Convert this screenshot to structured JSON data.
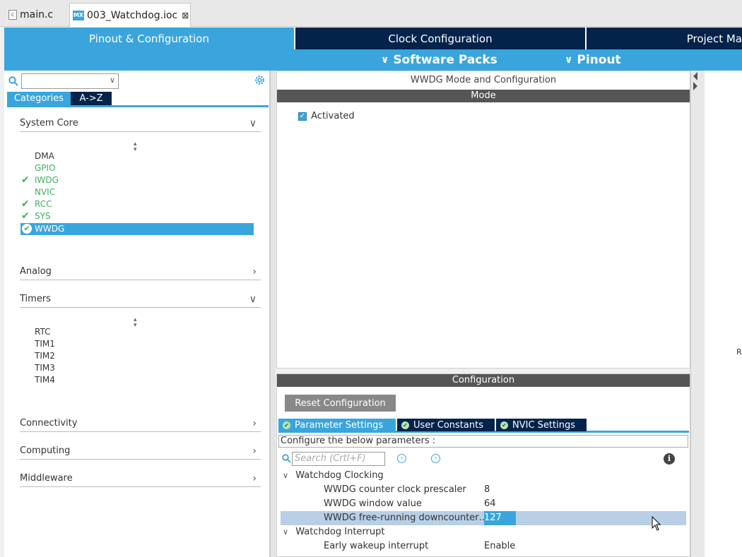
{
  "editor_tabs": [
    {
      "label": "main.c",
      "icon": "c-file-icon",
      "active": false
    },
    {
      "label": "003_Watchdog.ioc",
      "icon": "mx-icon",
      "active": true,
      "close": "⊠"
    }
  ],
  "top_nav": {
    "tabs": [
      "Pinout & Configuration",
      "Clock Configuration",
      "Project Ma"
    ],
    "subnav": [
      "Software Packs",
      "Pinout"
    ]
  },
  "left_panel": {
    "category_tabs": [
      "Categories",
      "A->Z"
    ],
    "sections": {
      "system_core": {
        "label": "System Core",
        "items": [
          {
            "label": "DMA",
            "state": "normal",
            "checked": false
          },
          {
            "label": "GPIO",
            "state": "green",
            "checked": false
          },
          {
            "label": "IWDG",
            "state": "green",
            "checked": true
          },
          {
            "label": "NVIC",
            "state": "green",
            "checked": false
          },
          {
            "label": "RCC",
            "state": "green",
            "checked": true
          },
          {
            "label": "SYS",
            "state": "green",
            "checked": true
          },
          {
            "label": "WWDG",
            "state": "selected",
            "checked": true
          }
        ]
      },
      "analog": {
        "label": "Analog"
      },
      "timers": {
        "label": "Timers",
        "items": [
          "RTC",
          "TIM1",
          "TIM2",
          "TIM3",
          "TIM4"
        ]
      },
      "connectivity": {
        "label": "Connectivity"
      },
      "computing": {
        "label": "Computing"
      },
      "middleware": {
        "label": "Middleware"
      }
    }
  },
  "mode_panel": {
    "title": "WWDG Mode and Configuration",
    "mode_header": "Mode",
    "activated_label": "Activated",
    "activated": true
  },
  "config_panel": {
    "header": "Configuration",
    "reset_button": "Reset Configuration",
    "tabs": [
      "Parameter Settings",
      "User Constants",
      "NVIC Settings"
    ],
    "description": "Configure the below parameters :",
    "search_placeholder": "Search (Crtl+F)",
    "groups": {
      "clocking": {
        "label": "Watchdog Clocking",
        "params": [
          {
            "name": "WWDG counter clock prescaler",
            "value": "8"
          },
          {
            "name": "WWDG window value",
            "value": "64"
          },
          {
            "name": "WWDG free-running downcounter…",
            "value": "127"
          }
        ]
      },
      "interrupt": {
        "label": "Watchdog Interrupt",
        "params": [
          {
            "name": "Early wakeup interrupt",
            "value": "Enable"
          }
        ]
      }
    }
  },
  "right_edge_text": "R",
  "colors": {
    "accent": "#3aa5dc",
    "navy": "#03234b",
    "green": "#3cb15c",
    "dark_bar": "#555555",
    "selected_row": "#b8cfe6"
  }
}
